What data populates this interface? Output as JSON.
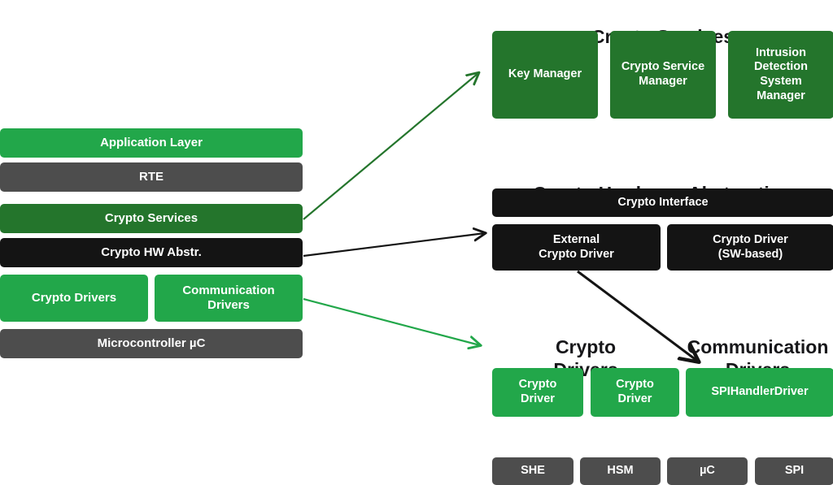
{
  "colors": {
    "green": "#22a74a",
    "dark_green": "#24752c",
    "gray": "#4d4d4d",
    "black": "#141414",
    "text_dark": "#17171a",
    "background": "#ffffff"
  },
  "left_stack": {
    "layers": [
      {
        "label": "Application Layer",
        "color": "#22a74a"
      },
      {
        "label": "RTE",
        "color": "#4d4d4d"
      },
      {
        "label": "Crypto Services",
        "color": "#24752c"
      },
      {
        "label": "Crypto HW Abstr.",
        "color": "#141414"
      },
      {
        "label": "Crypto Drivers",
        "color": "#22a74a"
      },
      {
        "label": "Communication\nDrivers",
        "color": "#22a74a"
      },
      {
        "label": "Microcontroller µC",
        "color": "#4d4d4d"
      }
    ]
  },
  "crypto_services": {
    "heading": "Crypto Services",
    "items": [
      {
        "label": "Key Manager"
      },
      {
        "label": "Crypto Service\nManager"
      },
      {
        "label": "Intrusion\nDetection\nSystem\nManager"
      }
    ]
  },
  "crypto_hardware_abstraction": {
    "heading": "Crypto Hardware Abstraction",
    "interface": {
      "label": "Crypto Interface"
    },
    "drivers": [
      {
        "label": "External\nCrypto Driver"
      },
      {
        "label": "Crypto Driver\n(SW-based)"
      }
    ]
  },
  "drivers_section": {
    "crypto_drivers_heading": "Crypto\nDrivers",
    "communication_drivers_heading": "Communication\nDrivers",
    "crypto_driver_items": [
      {
        "label": "Crypto\nDriver"
      },
      {
        "label": "Crypto\nDriver"
      }
    ],
    "communication_driver_items": [
      {
        "label": "SPIHandlerDriver"
      }
    ]
  },
  "hardware_row": {
    "items": [
      {
        "label": "SHE"
      },
      {
        "label": "HSM"
      },
      {
        "label": "µC"
      },
      {
        "label": "SPI"
      }
    ]
  },
  "connectors": [
    {
      "name": "crypto-services-arrow",
      "color": "#24752c"
    },
    {
      "name": "crypto-hw-abstraction-arrow",
      "color": "#141414"
    },
    {
      "name": "communication-drivers-arrow",
      "color": "#22a74a"
    },
    {
      "name": "external-driver-to-spi-arrow",
      "color": "#141414"
    }
  ]
}
